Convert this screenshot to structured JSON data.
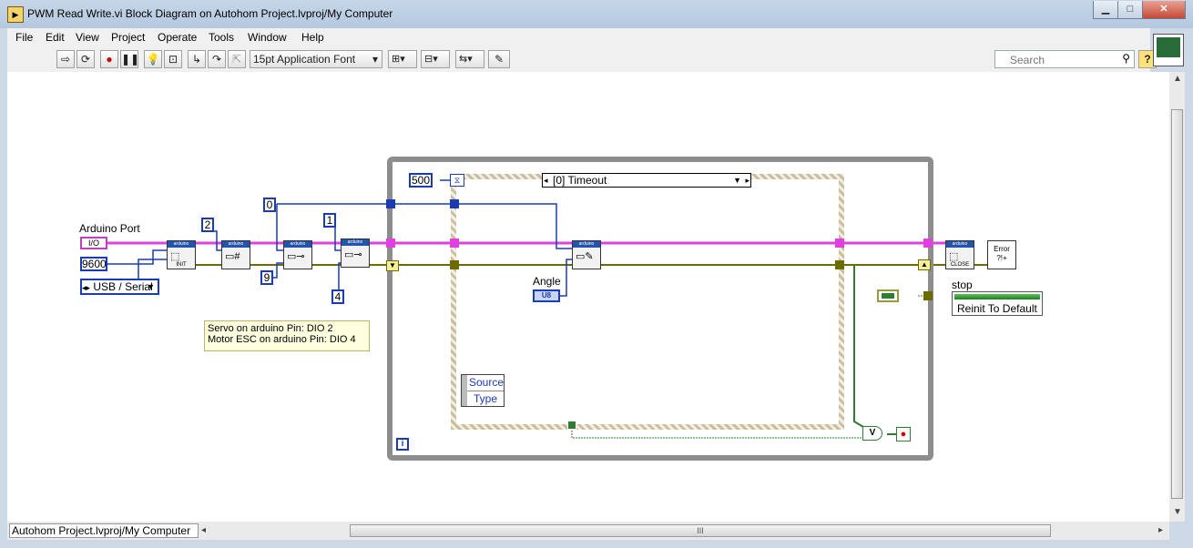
{
  "window": {
    "title": "PWM Read Write.vi Block Diagram on Autohom Project.lvproj/My Computer",
    "controls": {
      "minimize": "▁",
      "maximize": "□",
      "close": "✕"
    }
  },
  "menu": [
    "File",
    "Edit",
    "View",
    "Project",
    "Operate",
    "Tools",
    "Window",
    "Help"
  ],
  "toolbar": {
    "font": "15pt Application Font",
    "search_placeholder": "Search",
    "help": "?"
  },
  "diagram": {
    "arduino_port_label": "Arduino Port",
    "port_value": "I/O",
    "baud_rate": "9600",
    "connection_type": "USB / Serial",
    "const_2": "2",
    "const_0": "0",
    "const_9": "9",
    "const_1": "1",
    "const_4": "4",
    "timeout_ms": "500",
    "case_selector": "[0] Timeout",
    "angle_label": "Angle",
    "angle_type": "U8",
    "event_data": [
      "Source",
      "Type"
    ],
    "stop_label": "stop",
    "invoke_node": "Reinit To Default",
    "comment_lines": [
      "Servo on arduino Pin: DIO 2",
      "Motor ESC on arduino Pin:  DIO 4"
    ],
    "init_caption": "INIT",
    "close_caption": "CLOSE",
    "iteration": "i",
    "or_symbol": "V",
    "vi_header": "arduino",
    "error_handler": "Error"
  },
  "status": {
    "project_path": "Autohom Project.lvproj/My Computer"
  },
  "colors": {
    "wire_pink": "#e040e0",
    "wire_yellow": "#6b6b00",
    "wire_blue": "#1a3bb5",
    "wire_green": "#2e7d32",
    "constant_border": "#1a3bb5"
  }
}
